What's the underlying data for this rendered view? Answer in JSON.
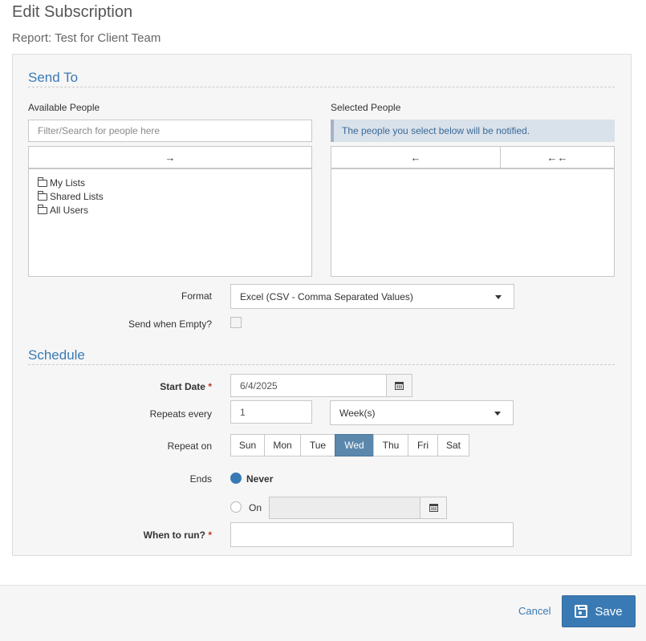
{
  "page": {
    "title": "Edit Subscription",
    "subtitle": "Report: Test for Client Team"
  },
  "send_to": {
    "heading": "Send To",
    "available": {
      "label": "Available People",
      "search_placeholder": "Filter/Search for people here",
      "add_arrow": "→",
      "tree": [
        {
          "label": "My Lists",
          "icon": "folder-icon"
        },
        {
          "label": "Shared Lists",
          "icon": "folder-icon"
        },
        {
          "label": "All Users",
          "icon": "folder-icon"
        }
      ]
    },
    "selected": {
      "label": "Selected People",
      "info": "The people you select below will be notified.",
      "remove_arrow": "←",
      "remove_all_arrow": "←←"
    }
  },
  "format": {
    "label": "Format",
    "value": "Excel (CSV - Comma Separated Values)"
  },
  "send_when_empty": {
    "label": "Send when Empty?",
    "checked": false
  },
  "schedule": {
    "heading": "Schedule",
    "start_date": {
      "label": "Start Date",
      "required_mark": "*",
      "value": "6/4/2025"
    },
    "repeats_every": {
      "label": "Repeats every",
      "value": "1",
      "unit": "Week(s)"
    },
    "repeat_on": {
      "label": "Repeat on",
      "days": [
        "Sun",
        "Mon",
        "Tue",
        "Wed",
        "Thu",
        "Fri",
        "Sat"
      ],
      "selected": "Wed"
    },
    "ends": {
      "label": "Ends",
      "never_label": "Never",
      "on_label": "On",
      "selected": "Never",
      "on_value": ""
    },
    "when_to_run": {
      "label": "When to run?",
      "required_mark": "*",
      "value": ""
    }
  },
  "footer": {
    "cancel_label": "Cancel",
    "save_label": "Save"
  },
  "colors": {
    "accent": "#3a7ab4",
    "active_day": "#5b87ac",
    "required": "#c0392b"
  }
}
